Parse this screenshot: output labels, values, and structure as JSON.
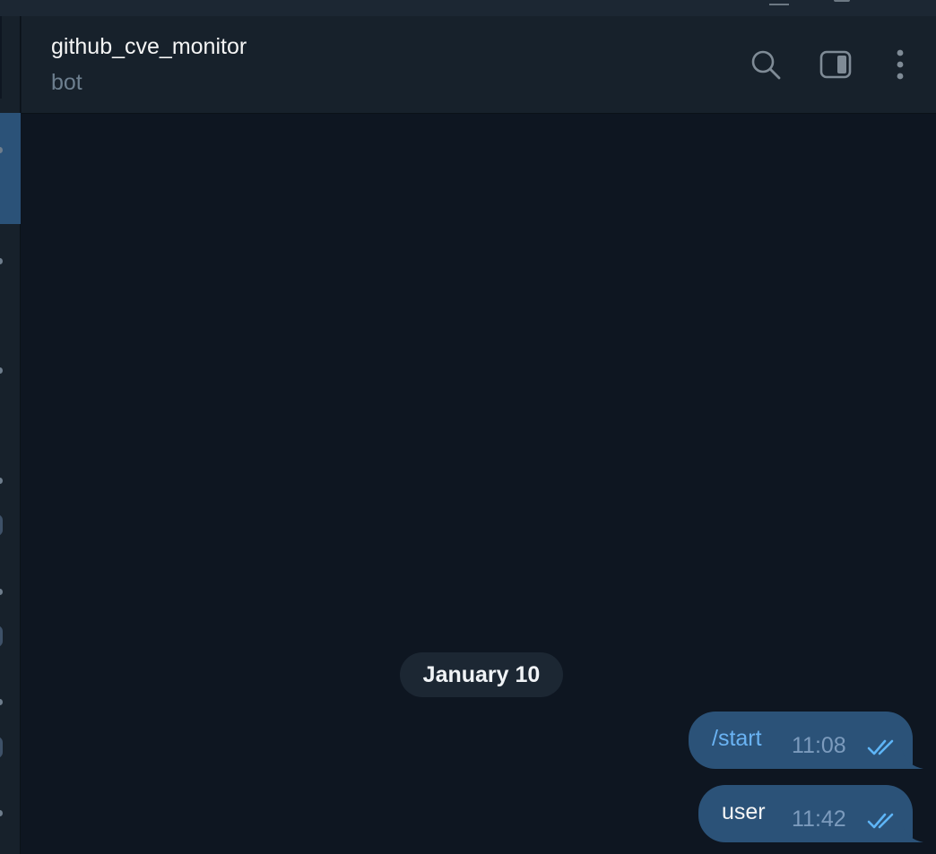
{
  "chat": {
    "title": "github_cve_monitor",
    "subtitle": "bot"
  },
  "date_separator": "January 10",
  "messages": [
    {
      "text": "/start",
      "time": "11:08",
      "status": "read",
      "is_command": true
    },
    {
      "text": "user",
      "time": "11:42",
      "status": "read",
      "is_command": false
    }
  ],
  "colors": {
    "background": "#0e1621",
    "header": "#17212b",
    "outgoing_bubble": "#2b5278",
    "command_text": "#6ab3f3",
    "check_marks": "#5eb5f7"
  },
  "icons": [
    "search-icon",
    "side-panel-icon",
    "more-vertical-icon",
    "double-check-icon"
  ]
}
